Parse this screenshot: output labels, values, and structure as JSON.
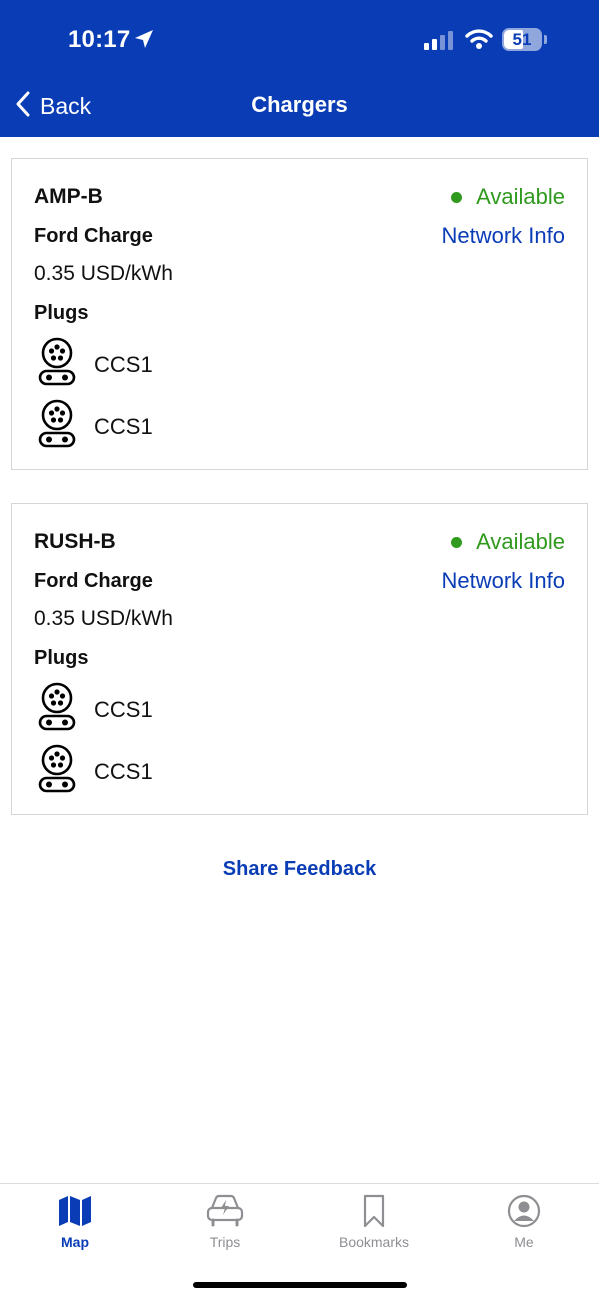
{
  "status_bar": {
    "time": "10:17",
    "battery": "51"
  },
  "nav": {
    "back_label": "Back",
    "title": "Chargers"
  },
  "chargers": [
    {
      "name": "AMP-B",
      "status": "Available",
      "network": "Ford Charge",
      "network_info_label": "Network Info",
      "price": "0.35 USD/kWh",
      "plugs_label": "Plugs",
      "plugs": [
        {
          "type": "CCS1"
        },
        {
          "type": "CCS1"
        }
      ]
    },
    {
      "name": "RUSH-B",
      "status": "Available",
      "network": "Ford Charge",
      "network_info_label": "Network Info",
      "price": "0.35 USD/kWh",
      "plugs_label": "Plugs",
      "plugs": [
        {
          "type": "CCS1"
        },
        {
          "type": "CCS1"
        }
      ]
    }
  ],
  "share_feedback_label": "Share Feedback",
  "tabs": [
    {
      "label": "Map",
      "icon": "map-icon",
      "active": true
    },
    {
      "label": "Trips",
      "icon": "car-charge-icon",
      "active": false
    },
    {
      "label": "Bookmarks",
      "icon": "bookmark-icon",
      "active": false
    },
    {
      "label": "Me",
      "icon": "person-icon",
      "active": false
    }
  ],
  "colors": {
    "brand": "#0a3db5",
    "available": "#2f9a1d",
    "inactive_tab": "#8e8e93"
  }
}
